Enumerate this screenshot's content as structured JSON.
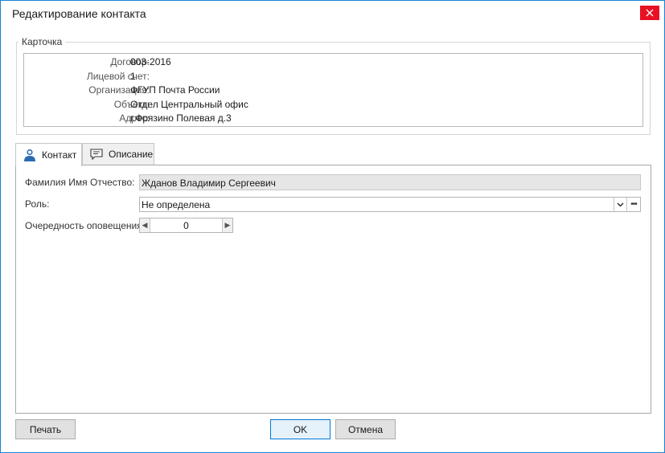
{
  "window": {
    "title": "Редактирование контакта"
  },
  "card": {
    "legend": "Карточка",
    "rows": [
      {
        "label": "Договор:",
        "value": "003-2016"
      },
      {
        "label": "Лицевой счет:",
        "value": "1"
      },
      {
        "label": "Организация:",
        "value": "ФГУП Почта России"
      },
      {
        "label": "Объект:",
        "value": "Отдел Центральный офис"
      },
      {
        "label": "Адрес:",
        "value": "г.Фрязино Полевая д.3"
      }
    ]
  },
  "tabs": [
    {
      "label": "Контакт",
      "icon": "person-icon",
      "active": true
    },
    {
      "label": "Описание",
      "icon": "comment-icon",
      "active": false
    }
  ],
  "contact": {
    "fio_label": "Фамилия Имя Отчество:",
    "fio_value": "Жданов Владимир Сергеевич",
    "role_label": "Роль:",
    "role_value": "Не определена",
    "order_label": "Очередность оповещения:",
    "order_value": "0"
  },
  "buttons": {
    "print": "Печать",
    "ok": "OK",
    "cancel": "Отмена"
  },
  "colors": {
    "accent": "#0078d7",
    "close": "#e81123",
    "readonly_field": "#e6e6e6"
  }
}
